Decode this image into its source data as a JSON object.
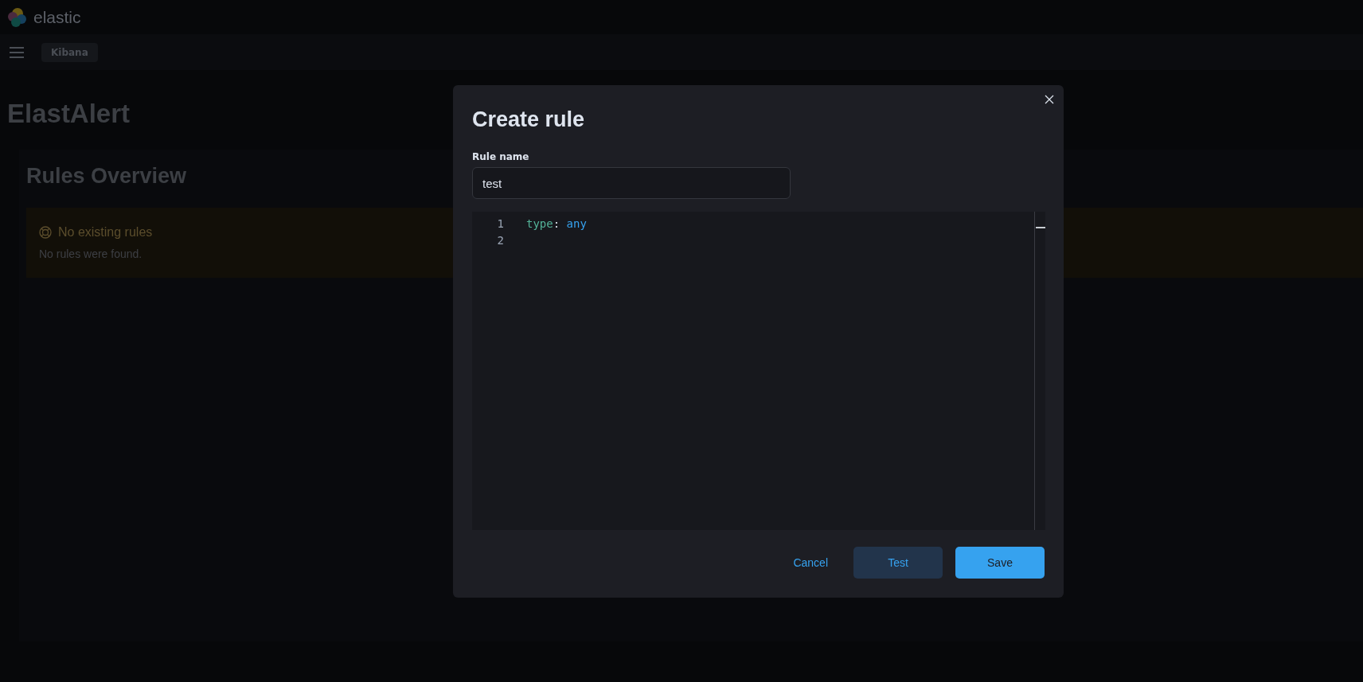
{
  "header": {
    "brand": "elastic"
  },
  "nav": {
    "breadcrumb": "Kibana"
  },
  "page": {
    "title": "ElastAlert",
    "section_title": "Rules Overview",
    "callout": {
      "title": "No existing rules",
      "text": "No rules were found."
    }
  },
  "modal": {
    "title": "Create rule",
    "rule_name": {
      "label": "Rule name",
      "value": "test"
    },
    "editor": {
      "lines": [
        {
          "number": "1",
          "tokens": [
            {
              "kind": "key",
              "text": "type"
            },
            {
              "kind": "punct",
              "text": ": "
            },
            {
              "kind": "value",
              "text": "any"
            }
          ]
        },
        {
          "number": "2"
        }
      ]
    },
    "buttons": [
      {
        "kind": "link",
        "label": "Cancel"
      },
      {
        "kind": "secondary",
        "label": "Test"
      },
      {
        "kind": "primary",
        "label": "Save"
      }
    ]
  }
}
